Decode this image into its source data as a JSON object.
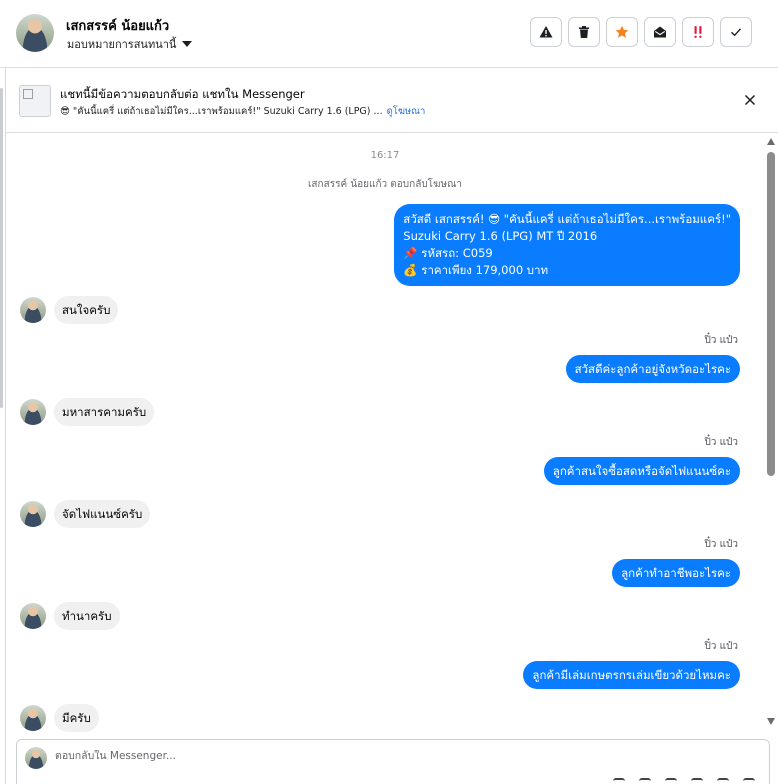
{
  "header": {
    "contact_name": "เสกสรรค์ น้อยแก้ว",
    "assign_label": "มอบหมายการสนทนานี้",
    "actions": [
      {
        "name": "report-spam-button",
        "icon": "warning-icon"
      },
      {
        "name": "delete-button",
        "icon": "trash-icon"
      },
      {
        "name": "star-button",
        "icon": "star-icon"
      },
      {
        "name": "mark-unread-button",
        "icon": "envelope-open-icon"
      },
      {
        "name": "follow-up-button",
        "icon": "double-exclamation-icon"
      },
      {
        "name": "mark-done-button",
        "icon": "check-icon"
      }
    ]
  },
  "ad_banner": {
    "title": "แชทนี้มีข้อความตอบกลับต่อ แชทใน Messenger",
    "subtitle": "😎 \"คันนี้แครี่ แต่ถ้าเธอไม่มีใคร...เราพร้อมแคร์!\" Suzuki Carry 1.6 (LPG) ...",
    "link": "ดูโฆษณา"
  },
  "thread": {
    "time": "16:17",
    "system_line": "เสกสรรค์ น้อยแก้ว ตอบกลับโฆษณา",
    "welcome_lines": [
      "สวัสดี เสกสรรค์! 😎 \"คันนี้แครี่ แต่ถ้าเธอไม่มีใคร...เราพร้อมแคร์!\"",
      "Suzuki Carry 1.6 (LPG) MT ปี 2016",
      "📌 รหัสรถ: C059",
      "💰 ราคาเพียง 179,000 บาท"
    ],
    "messages": [
      {
        "dir": "in",
        "text": "สนใจครับ"
      },
      {
        "dir": "out",
        "sender": "ปิ๋ว แป๋ว",
        "text": "สวัสดีค่ะลูกค้าอยู่จังหวัดอะไรคะ"
      },
      {
        "dir": "in",
        "text": "มหาสารคามครับ"
      },
      {
        "dir": "out",
        "sender": "ปิ๋ว แป๋ว",
        "text": "ลูกค้าสนใจซื้อสดหรือจัดไฟแนนซ์คะ"
      },
      {
        "dir": "in",
        "text": "จัดไฟแนนซ์ครับ"
      },
      {
        "dir": "out",
        "sender": "ปิ๋ว แป๋ว",
        "text": "ลูกค้าทำอาชีพอะไรคะ"
      },
      {
        "dir": "in",
        "text": "ทำนาครับ"
      },
      {
        "dir": "out",
        "sender": "ปิ๋ว แป๋ว",
        "text": "ลูกค้ามีเล่มเกษตรกรเล่มเขียวด้วยไหมคะ"
      },
      {
        "dir": "in",
        "text": "มีครับ"
      }
    ]
  },
  "reply": {
    "placeholder": "ตอบกลับใน Messenger..."
  },
  "colors": {
    "outgoing_bubble": "#0a7cff",
    "incoming_bubble": "#f0f0f0",
    "link": "#216fdb",
    "star": "#f5821f",
    "follow_up": "#e41e3f"
  }
}
